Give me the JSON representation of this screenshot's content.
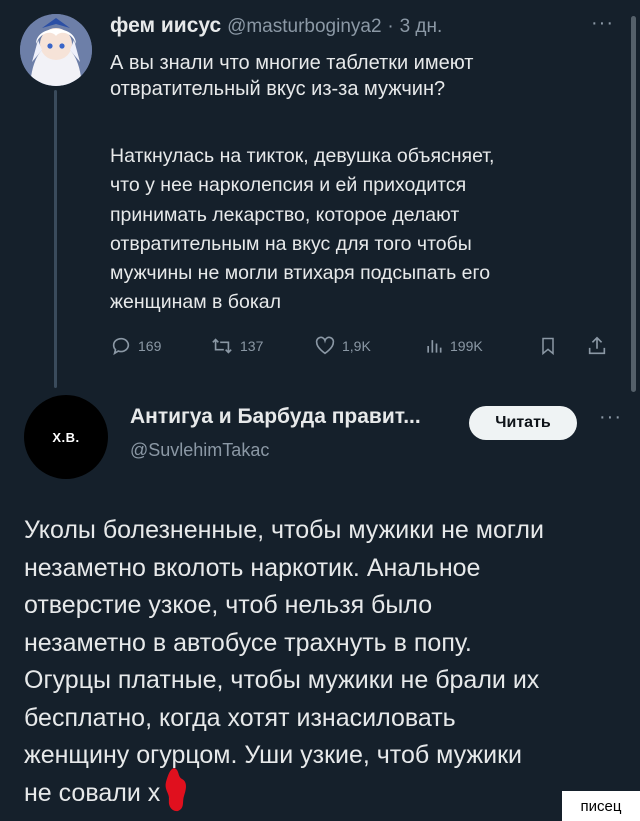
{
  "tweet1": {
    "author_name": "фем иисус",
    "handle": "@masturboginya2",
    "separator": "·",
    "time": "3 дн.",
    "more": "···",
    "text": "А вы знали что многие таблетки имеют\nотвратительный вкус из-за мужчин?",
    "text2": "Наткнулась на тикток, девушка объясняет,\nчто у нее нарколепсия и ей приходится\nпринимать лекарство, которое делают\nотвратительным на вкус для того чтобы\nмужчины не могли втихаря подсыпать его\nженщинам в бокал",
    "actions": {
      "replies": "169",
      "reposts": "137",
      "likes": "1,9K",
      "views": "199K"
    }
  },
  "tweet2": {
    "avatar_text": "Х.В.",
    "author_name": "Антигуа и Барбуда правит...",
    "handle": "@SuvlehimTakac",
    "follow_label": "Читать",
    "more": "···",
    "text": "Уколы болезненные, чтобы мужики не могли\nнезаметно вколоть наркотик. Анальное\nотверстие узкое, чтоб нельзя было\nнезаметно в автобусе трахнуть в попу.\nОгурцы платные, чтобы мужики не брали их\nбесплатно, когда хотят изнасиловать\nженщину огурцом. Уши узкие, чтоб мужики\nне совали х й"
  },
  "colors": {
    "background": "#15202b",
    "text": "#e7e9ea",
    "muted": "#8b98a5",
    "button_bg": "#eff3f4",
    "censor": "#e0101e"
  },
  "watermark": "писец"
}
